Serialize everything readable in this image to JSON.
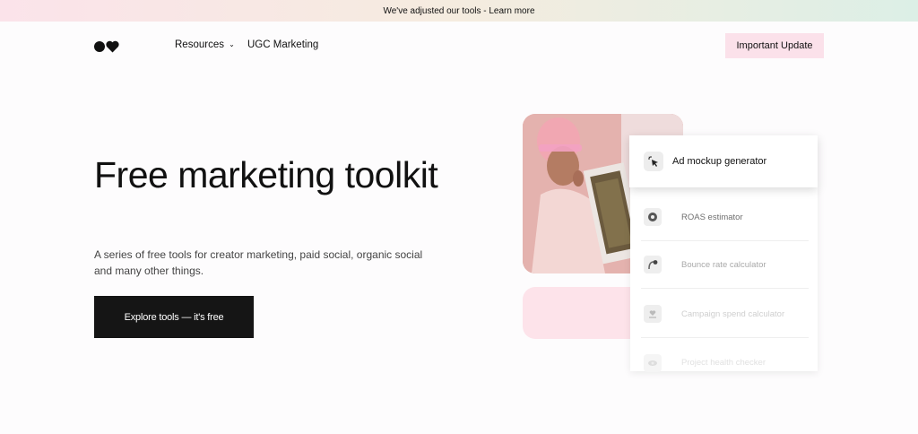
{
  "banner": {
    "text": "We've adjusted our tools - Learn more"
  },
  "nav": {
    "resources_label": "Resources",
    "ugc_label": "UGC Marketing",
    "update_label": "Important Update"
  },
  "hero": {
    "title": "Free marketing toolkit",
    "subtitle": "A series of free tools for creator marketing, paid social, organic social and many other things.",
    "cta_label": "Explore tools — it's free"
  },
  "tools": {
    "active": {
      "label": "Ad mockup generator",
      "icon": "cursor-click-icon"
    },
    "items": [
      {
        "label": "ROAS estimator",
        "icon": "coin-icon",
        "color": "#6f6f6f"
      },
      {
        "label": "Bounce rate calculator",
        "icon": "bounce-icon",
        "color": "#a9a9a9"
      },
      {
        "label": "Campaign spend calculator",
        "icon": "heart-hand-icon",
        "color": "#cfcfcf"
      },
      {
        "label": "Project health checker",
        "icon": "eye-icon",
        "color": "#e1e1e1"
      }
    ]
  },
  "colors": {
    "accent_pink": "#fbe1ea",
    "cta_bg": "#151515"
  }
}
